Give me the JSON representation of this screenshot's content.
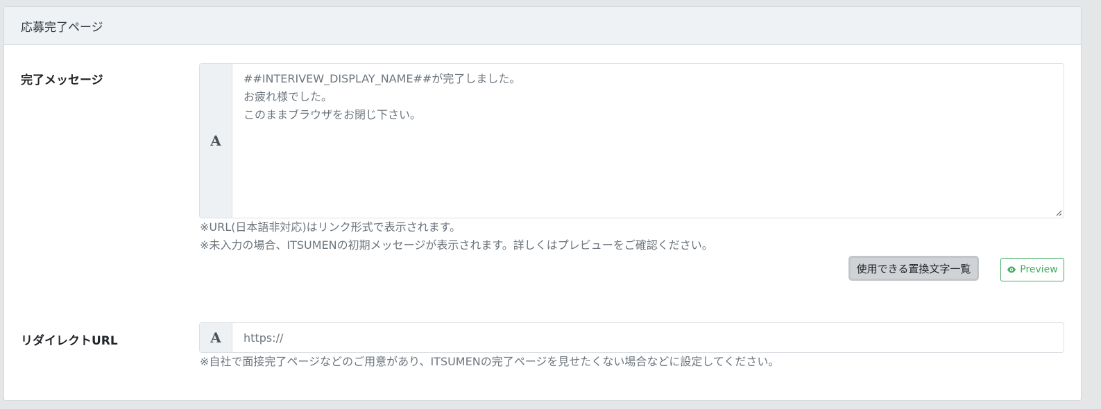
{
  "card": {
    "title": "応募完了ページ"
  },
  "completion_message": {
    "label": "完了メッセージ",
    "addon": "A",
    "value": "##INTERIVEW_DISPLAY_NAME##が完了しました。\nお疲れ様でした。\nこのままブラウザをお閉じ下さい。",
    "note1": "※URL(日本語非対応)はリンク形式で表示されます。",
    "note2": "※未入力の場合、ITSUMENの初期メッセージが表示されます。詳しくはプレビューをご確認ください。",
    "vars_button": "使用できる置換文字一覧",
    "preview_button": "Preview"
  },
  "redirect_url": {
    "label": "リダイレクトURL",
    "addon": "A",
    "placeholder": "https://",
    "note": "※自社で面接完了ページなどのご用意があり、ITSUMENの完了ページを見せたくない場合などに設定してください。"
  },
  "colors": {
    "accent_green": "#3fae5d",
    "header_bg": "#eef2f5",
    "muted_text": "#6c757d"
  }
}
